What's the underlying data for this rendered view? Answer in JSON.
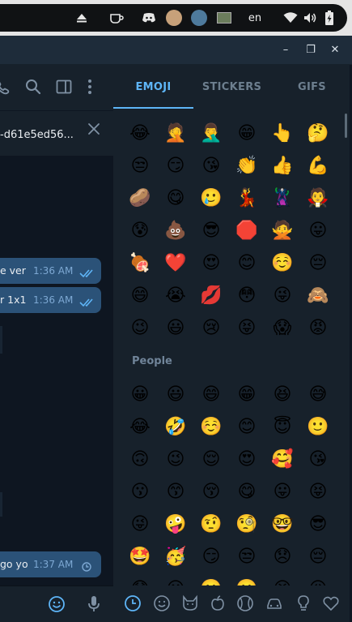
{
  "system_bar": {
    "language": "en",
    "icons": [
      "eject-icon",
      "coffee-icon",
      "discord-icon",
      "app-icon-1",
      "app-icon-2",
      "app-icon-3",
      "wifi-icon",
      "volume-icon",
      "battery-icon"
    ]
  },
  "window": {
    "minimize": "–",
    "restore": "❐",
    "close": "✕"
  },
  "chat": {
    "pinned_text": "-d61e5ed56...",
    "messages": [
      {
        "text": "e ver",
        "time": "1:36 AM",
        "status": "read"
      },
      {
        "text": "r 1x1",
        "time": "1:36 AM",
        "status": "read"
      },
      {
        "text": "go yo",
        "time": "1:37 AM",
        "status": "pending"
      }
    ]
  },
  "emoji_panel": {
    "tabs": [
      {
        "label": "EMOJI",
        "active": true
      },
      {
        "label": "STICKERS",
        "active": false
      },
      {
        "label": "GIFS",
        "active": false
      }
    ],
    "recent_rows": [
      [
        "😂",
        "🤦",
        "🤦‍♂️",
        "😁",
        "👆",
        "🤔"
      ],
      [
        "😒",
        "😏",
        "😘",
        "👏",
        "👍",
        "💪"
      ],
      [
        "🥔",
        "😋",
        "🥲",
        "💃",
        "🦹",
        "🧛"
      ],
      [
        "😰",
        "💩",
        "😎",
        "🛑",
        "🙅",
        "😛"
      ],
      [
        "🍖",
        "❤️",
        "😍",
        "😊",
        "☺️",
        "😔"
      ],
      [
        "😄",
        "😭",
        "💋",
        "😳",
        "😜",
        "🙈"
      ],
      [
        "😉",
        "😃",
        "😢",
        "😝",
        "😱",
        "😡"
      ]
    ],
    "section_title": "People",
    "people_rows": [
      [
        "😀",
        "😃",
        "😄",
        "😁",
        "😆",
        "😅"
      ],
      [
        "😂",
        "🤣",
        "☺️",
        "😊",
        "😇",
        "🙂"
      ],
      [
        "🙃",
        "😉",
        "😌",
        "😍",
        "🥰",
        "😘"
      ],
      [
        "😗",
        "😙",
        "😚",
        "😋",
        "😛",
        "😝"
      ],
      [
        "😜",
        "🤪",
        "🤨",
        "🧐",
        "🤓",
        "😎"
      ],
      [
        "🤩",
        "🥳",
        "😏",
        "😒",
        "😞",
        "😔"
      ],
      [
        "😟",
        "😕",
        "🙁",
        "☹️",
        "😣",
        "😖"
      ]
    ],
    "categories": [
      "recent-icon",
      "smiley-icon",
      "animal-icon",
      "food-icon",
      "sports-icon",
      "travel-icon",
      "objects-icon",
      "symbols-icon"
    ],
    "colors": {
      "accent": "#5eb5f7",
      "panel": "#17212b",
      "bubble": "#2b5278"
    }
  }
}
